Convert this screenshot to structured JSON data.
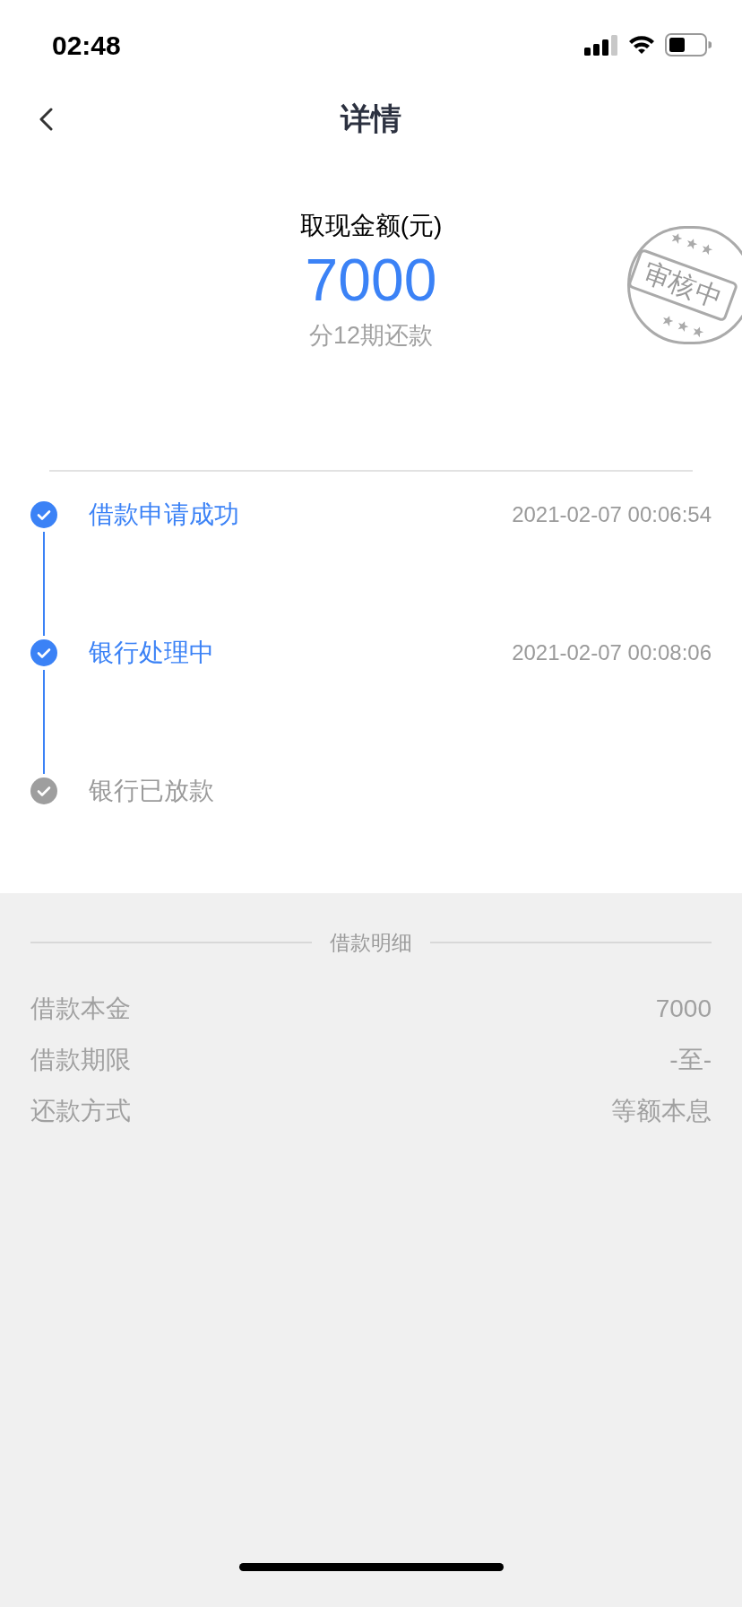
{
  "status_bar": {
    "time": "02:48"
  },
  "nav": {
    "title": "详情"
  },
  "summary": {
    "label": "取现金额(元)",
    "amount": "7000",
    "installments": "分12期还款",
    "stamp": "审核中"
  },
  "timeline": [
    {
      "label": "借款申请成功",
      "time": "2021-02-07 00:06:54",
      "completed": true
    },
    {
      "label": "银行处理中",
      "time": "2021-02-07 00:08:06",
      "completed": true
    },
    {
      "label": "银行已放款",
      "completed": false
    }
  ],
  "details": {
    "title": "借款明细",
    "rows": [
      {
        "label": "借款本金",
        "value": "7000"
      },
      {
        "label": "借款期限",
        "value": "-至-"
      },
      {
        "label": "还款方式",
        "value": "等额本息"
      }
    ]
  }
}
